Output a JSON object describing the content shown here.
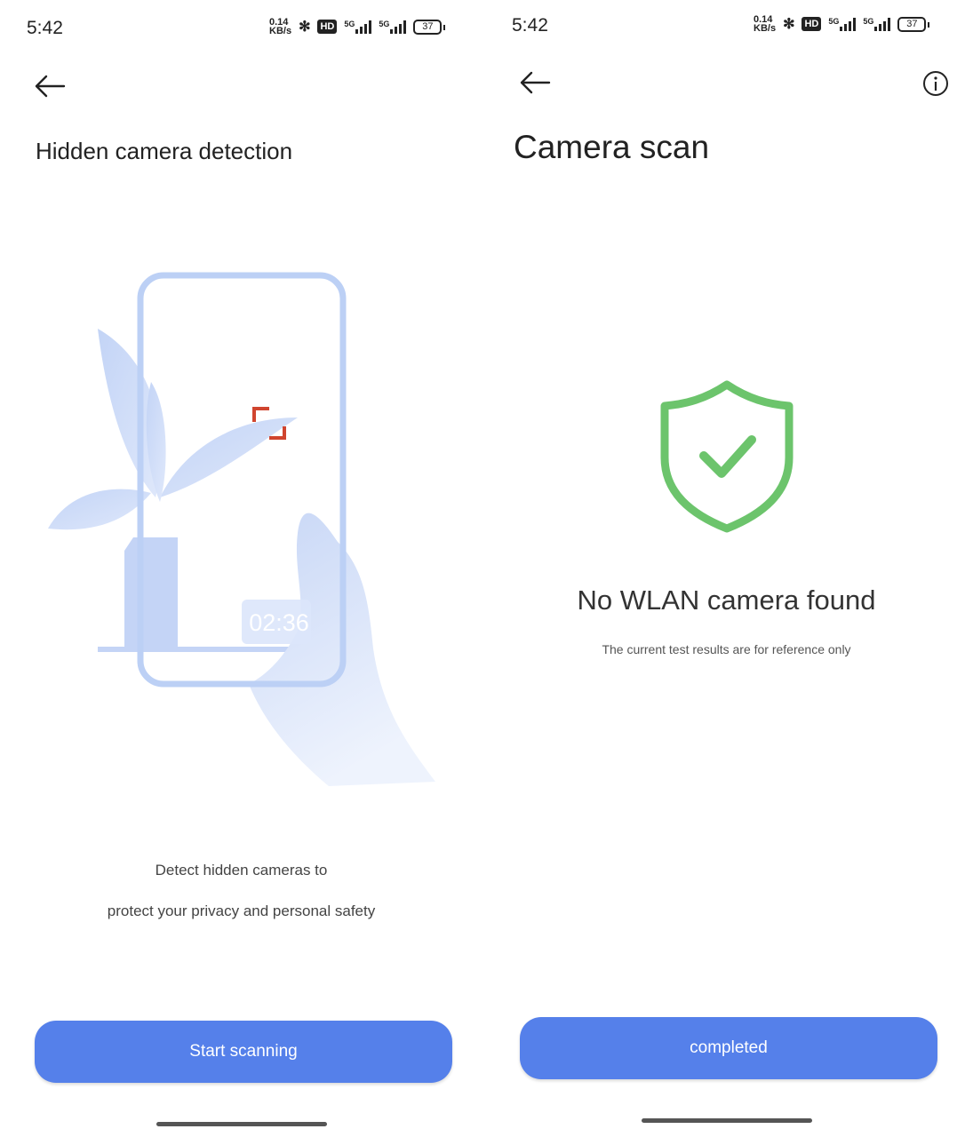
{
  "status_bar": {
    "time": "5:42",
    "net_speed_value": "0.14",
    "net_speed_unit": "KB/s",
    "hd": "HD",
    "sim1": "5G",
    "sim2": "5G",
    "battery": "37"
  },
  "left": {
    "title": "Hidden camera detection",
    "illustration_timer": "02:36",
    "description_line1": "Detect hidden cameras to",
    "description_line2": "protect your privacy and personal safety",
    "button": "Start scanning"
  },
  "right": {
    "title": "Camera scan",
    "result": "No WLAN camera found",
    "note": "The current test results are for reference only",
    "button": "completed"
  },
  "colors": {
    "accent": "#5580ea",
    "success": "#6cc46c",
    "marker": "#d0452f"
  }
}
